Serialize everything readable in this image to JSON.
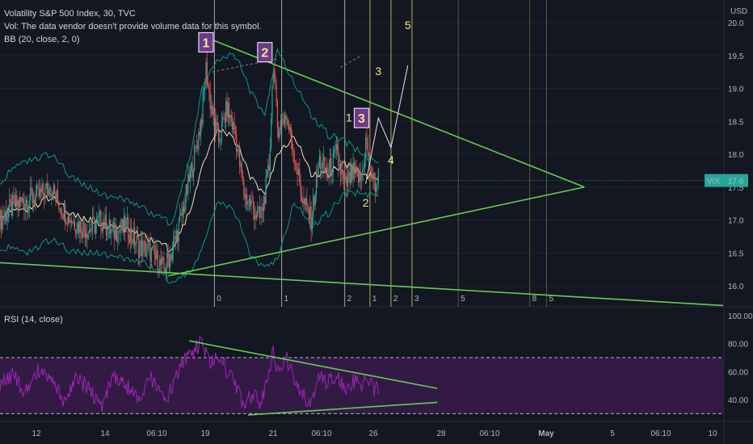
{
  "header": {
    "title": "Volatility S&P 500 Index, 30, TVC",
    "vol_note": "Vol: The data vendor doesn't provide volume data for this symbol.",
    "bb_label": "BB (20, close, 2, 0)",
    "rsi_label": "RSI (14, close)"
  },
  "colors": {
    "background": "#131722",
    "candle_up": "#26a69a",
    "candle_down": "#ef5350",
    "bb_band": "#089981",
    "bb_basis": "#f5e3b3",
    "trendline": "#66cc55",
    "rsi_line": "#9c27b0",
    "rsi_band": "#4a1d5e",
    "wave_label_bg": "#6b3a8a",
    "wave_label_text": "#f0e68c",
    "price_badge": "#26a69a"
  },
  "chart_data": [
    {
      "type": "candlestick",
      "title": "Volatility S&P 500 Index, 30, TVC",
      "currency": "USD",
      "y_ticks": [
        16.0,
        16.5,
        17.0,
        17.5,
        18.0,
        18.5,
        19.0,
        19.5,
        20.0
      ],
      "ylim": [
        15.7,
        20.15
      ],
      "x_tick_labels": [
        "12",
        "14",
        "06:10",
        "19",
        "21",
        "06:10",
        "26",
        "28",
        "06:10",
        "May",
        "5",
        "06:10",
        "10"
      ],
      "last_price": {
        "symbol": "VIX",
        "value": "17.6"
      },
      "approx_close_path": [
        [
          0,
          17.0
        ],
        [
          3,
          17.2
        ],
        [
          6,
          17.3
        ],
        [
          9,
          17.35
        ],
        [
          12,
          17.5
        ],
        [
          15,
          17.15
        ],
        [
          18,
          16.95
        ],
        [
          21,
          16.85
        ],
        [
          24,
          17.0
        ],
        [
          27,
          16.8
        ],
        [
          30,
          16.9
        ],
        [
          33,
          16.6
        ],
        [
          36,
          16.5
        ],
        [
          39,
          16.25
        ],
        [
          41,
          16.55
        ],
        [
          43,
          17.0
        ],
        [
          45,
          17.6
        ],
        [
          47,
          18.2
        ],
        [
          48,
          18.6
        ],
        [
          49,
          19.3
        ],
        [
          50,
          18.8
        ],
        [
          52,
          18.2
        ],
        [
          54,
          18.7
        ],
        [
          56,
          18.3
        ],
        [
          58,
          17.4
        ],
        [
          60,
          17.2
        ],
        [
          62,
          17.0
        ],
        [
          64,
          17.8
        ],
        [
          65,
          19.4
        ],
        [
          66,
          18.4
        ],
        [
          68,
          18.6
        ],
        [
          70,
          18.0
        ],
        [
          72,
          17.3
        ],
        [
          74,
          17.0
        ],
        [
          76,
          17.9
        ],
        [
          78,
          17.7
        ],
        [
          80,
          18.0
        ],
        [
          82,
          17.5
        ],
        [
          84,
          17.7
        ],
        [
          86,
          17.6
        ],
        [
          87,
          18.2
        ],
        [
          88,
          17.8
        ],
        [
          89,
          17.5
        ],
        [
          90,
          17.65
        ]
      ],
      "bollinger": {
        "period": 20,
        "stddev": 2,
        "basis_path": [
          [
            0,
            17.1
          ],
          [
            6,
            17.15
          ],
          [
            12,
            17.35
          ],
          [
            18,
            17.05
          ],
          [
            24,
            16.95
          ],
          [
            30,
            16.85
          ],
          [
            36,
            16.7
          ],
          [
            41,
            16.55
          ],
          [
            45,
            17.1
          ],
          [
            48,
            17.8
          ],
          [
            52,
            18.4
          ],
          [
            56,
            18.2
          ],
          [
            60,
            17.6
          ],
          [
            63,
            17.4
          ],
          [
            66,
            18.0
          ],
          [
            70,
            18.3
          ],
          [
            74,
            17.7
          ],
          [
            78,
            17.7
          ],
          [
            82,
            17.85
          ],
          [
            86,
            17.7
          ],
          [
            90,
            17.65
          ]
        ],
        "upper_path": [
          [
            0,
            17.6
          ],
          [
            6,
            17.9
          ],
          [
            12,
            18.0
          ],
          [
            18,
            17.6
          ],
          [
            24,
            17.4
          ],
          [
            30,
            17.3
          ],
          [
            36,
            17.1
          ],
          [
            41,
            16.95
          ],
          [
            45,
            17.9
          ],
          [
            48,
            19.0
          ],
          [
            52,
            19.45
          ],
          [
            56,
            19.5
          ],
          [
            60,
            18.9
          ],
          [
            63,
            18.6
          ],
          [
            66,
            19.6
          ],
          [
            70,
            19.1
          ],
          [
            74,
            18.6
          ],
          [
            78,
            18.3
          ],
          [
            82,
            18.2
          ],
          [
            86,
            18.0
          ],
          [
            90,
            17.9
          ]
        ],
        "lower_path": [
          [
            0,
            16.6
          ],
          [
            6,
            16.5
          ],
          [
            12,
            16.7
          ],
          [
            18,
            16.5
          ],
          [
            24,
            16.5
          ],
          [
            30,
            16.4
          ],
          [
            36,
            16.3
          ],
          [
            41,
            16.05
          ],
          [
            45,
            16.2
          ],
          [
            48,
            16.55
          ],
          [
            52,
            17.3
          ],
          [
            56,
            17.1
          ],
          [
            60,
            16.4
          ],
          [
            63,
            16.3
          ],
          [
            66,
            16.4
          ],
          [
            70,
            17.3
          ],
          [
            74,
            16.9
          ],
          [
            78,
            17.1
          ],
          [
            82,
            17.4
          ],
          [
            86,
            17.4
          ],
          [
            90,
            17.4
          ]
        ]
      },
      "trendlines": [
        {
          "name": "upper",
          "from": [
            50,
            19.75
          ],
          "to": [
            139,
            17.5
          ]
        },
        {
          "name": "lower",
          "from": [
            40,
            16.15
          ],
          "to": [
            139,
            17.5
          ]
        },
        {
          "name": "support",
          "from": [
            0,
            16.35
          ],
          "to": [
            172,
            15.7
          ]
        }
      ],
      "wave_boxes": [
        {
          "label": "1",
          "x": 49,
          "y": 19.7
        },
        {
          "label": "2",
          "x": 63,
          "y": 19.55
        },
        {
          "label": "3",
          "x": 86,
          "y": 18.55
        }
      ],
      "wave_labels": [
        {
          "label": "1",
          "x": 83,
          "y": 18.5
        },
        {
          "label": "2",
          "x": 87,
          "y": 17.2
        },
        {
          "label": "3",
          "x": 90,
          "y": 19.2
        },
        {
          "label": "4",
          "x": 93,
          "y": 17.85
        },
        {
          "label": "5",
          "x": 97,
          "y": 19.9
        }
      ],
      "projection_path": [
        [
          87,
          17.55
        ],
        [
          90,
          18.55
        ],
        [
          93,
          18.1
        ],
        [
          97,
          19.35
        ]
      ],
      "vertical_markers": [
        {
          "label": "0",
          "x": 51
        },
        {
          "label": "1",
          "x": 67
        },
        {
          "label": "2",
          "x": 82
        },
        {
          "label": "1",
          "x": 88
        },
        {
          "label": "2",
          "x": 93
        },
        {
          "label": "3",
          "x": 98
        },
        {
          "label": "5",
          "x": 109
        },
        {
          "label": "8",
          "x": 126
        },
        {
          "label": "5",
          "x": 130
        }
      ]
    },
    {
      "type": "line",
      "title": "RSI (14, close)",
      "y_ticks": [
        40.0,
        60.0,
        80.0,
        100.0
      ],
      "ylim": [
        22,
        100
      ],
      "band": [
        30,
        70
      ],
      "approx_rsi_path": [
        [
          0,
          52
        ],
        [
          3,
          58
        ],
        [
          6,
          45
        ],
        [
          9,
          62
        ],
        [
          12,
          55
        ],
        [
          15,
          40
        ],
        [
          18,
          56
        ],
        [
          21,
          48
        ],
        [
          24,
          35
        ],
        [
          27,
          58
        ],
        [
          30,
          50
        ],
        [
          33,
          42
        ],
        [
          36,
          55
        ],
        [
          39,
          38
        ],
        [
          41,
          48
        ],
        [
          43,
          66
        ],
        [
          45,
          72
        ],
        [
          47,
          78
        ],
        [
          48,
          82
        ],
        [
          50,
          64
        ],
        [
          52,
          72
        ],
        [
          54,
          60
        ],
        [
          56,
          52
        ],
        [
          58,
          36
        ],
        [
          60,
          44
        ],
        [
          62,
          38
        ],
        [
          64,
          58
        ],
        [
          65,
          75
        ],
        [
          66,
          62
        ],
        [
          68,
          70
        ],
        [
          70,
          55
        ],
        [
          72,
          44
        ],
        [
          74,
          36
        ],
        [
          76,
          56
        ],
        [
          78,
          52
        ],
        [
          80,
          58
        ],
        [
          82,
          46
        ],
        [
          84,
          54
        ],
        [
          86,
          50
        ],
        [
          87,
          58
        ],
        [
          88,
          52
        ],
        [
          89,
          46
        ],
        [
          90,
          48
        ]
      ],
      "trendlines": [
        {
          "name": "upper",
          "from": [
            45,
            82
          ],
          "to": [
            104,
            48
          ]
        },
        {
          "name": "lower",
          "from": [
            59,
            29
          ],
          "to": [
            104,
            38
          ]
        }
      ]
    }
  ]
}
